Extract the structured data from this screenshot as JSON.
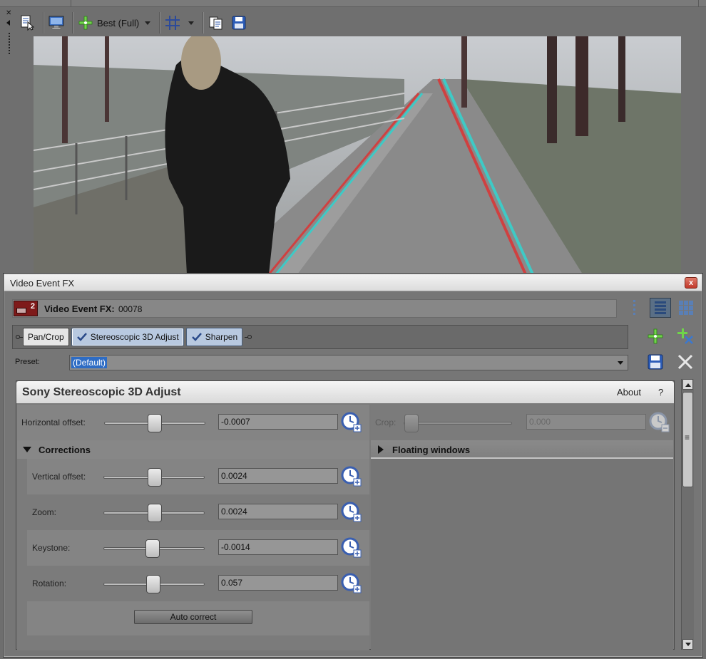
{
  "preview": {
    "quality_label": "Best (Full)"
  },
  "dialog": {
    "title": "Video Event FX",
    "close_glyph": "x",
    "header_label": "Video Event FX:",
    "header_value": "00078",
    "event_number": "2",
    "chain": [
      {
        "label": "Pan/Crop",
        "checked": false
      },
      {
        "label": "Stereoscopic 3D Adjust",
        "checked": true
      },
      {
        "label": "Sharpen",
        "checked": true
      }
    ],
    "preset_label": "Preset:",
    "preset_value": "(Default)",
    "plugin_name": "Sony Stereoscopic 3D Adjust",
    "about_label": "About",
    "help_label": "?",
    "horizontal_offset": {
      "label": "Horizontal offset:",
      "value": "-0.0007",
      "slider": 0.5
    },
    "corrections_label": "Corrections",
    "vertical_offset": {
      "label": "Vertical offset:",
      "value": "0.0024",
      "slider": 0.5
    },
    "zoom": {
      "label": "Zoom:",
      "value": "0.0024",
      "slider": 0.5
    },
    "keystone": {
      "label": "Keystone:",
      "value": "-0.0014",
      "slider": 0.48
    },
    "rotation": {
      "label": "Rotation:",
      "value": "0.057",
      "slider": 0.5
    },
    "auto_correct_label": "Auto correct",
    "crop": {
      "label": "Crop:",
      "value": "0.000",
      "slider": 0.0
    },
    "floating_windows_label": "Floating windows"
  },
  "colors": {
    "selection": "#2e6cc4",
    "accent_green": "#6fd34a",
    "keyframe_blue": "#3a5fb0"
  }
}
